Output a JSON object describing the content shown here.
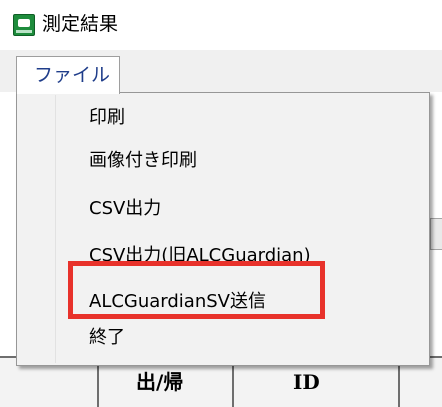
{
  "window": {
    "title": "測定結果",
    "icon": "app-logo-icon"
  },
  "menubar": {
    "file_label": "ファイル"
  },
  "file_menu": {
    "items": [
      {
        "label": "印刷"
      },
      {
        "label": "画像付き印刷"
      },
      {
        "label": "CSV出力"
      },
      {
        "label": "CSV出力(旧ALCGuardian)"
      },
      {
        "label": "ALCGuardianSV送信",
        "highlighted": true
      },
      {
        "label": "終了"
      }
    ]
  },
  "table": {
    "headers": [
      "出/帰",
      "ID"
    ]
  },
  "colors": {
    "highlight_border": "#e8322b",
    "menu_background": "#f2f2f2",
    "menu_text": "#1f3d8a"
  }
}
